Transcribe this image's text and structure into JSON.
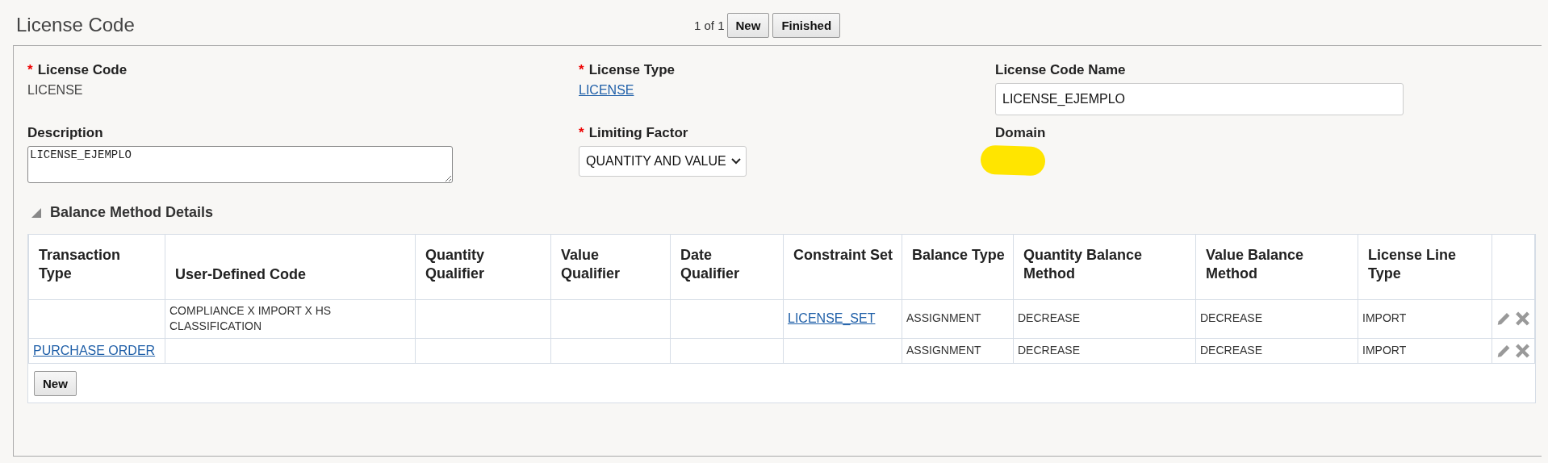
{
  "page": {
    "title": "License Code",
    "pager": "1 of 1",
    "buttons": [
      "New",
      "Finished"
    ]
  },
  "form": {
    "required_mark": "*",
    "license_code": {
      "label": "License Code",
      "required": true,
      "value": "LICENSE"
    },
    "license_type": {
      "label": "License Type",
      "required": true,
      "link": "LICENSE"
    },
    "license_code_name": {
      "label": "License Code Name",
      "required": false,
      "value": "LICENSE_EJEMPLO"
    },
    "description": {
      "label": "Description",
      "required": false,
      "value": "LICENSE_EJEMPLO"
    },
    "limiting_factor": {
      "label": "Limiting Factor",
      "required": true,
      "value": "QUANTITY AND VALUE"
    },
    "domain": {
      "label": "Domain",
      "required": false,
      "redacted": true
    }
  },
  "balance_section": {
    "title": "Balance Method Details",
    "expanded": true,
    "table": {
      "columns": [
        "Transaction Type",
        "User-Defined Code",
        "Quantity Qualifier",
        "Value Qualifier",
        "Date Qualifier",
        "Constraint Set",
        "Balance Type",
        "Quantity Balance Method",
        "Value Balance Method",
        "License Line Type"
      ],
      "rows": [
        {
          "cells": [
            {},
            {
              "text": "COMPLIANCE X IMPORT X HS CLASSIFICATION"
            },
            {},
            {},
            {},
            {
              "text": "LICENSE_SET",
              "link": true
            },
            {
              "text": "ASSIGNMENT"
            },
            {
              "text": "DECREASE"
            },
            {
              "text": "DECREASE"
            },
            {
              "text": "IMPORT"
            }
          ]
        },
        {
          "cells": [
            {
              "text": "PURCHASE ORDER",
              "link": true
            },
            {},
            {},
            {},
            {},
            {},
            {
              "text": "ASSIGNMENT"
            },
            {
              "text": "DECREASE"
            },
            {
              "text": "DECREASE"
            },
            {
              "text": "IMPORT"
            }
          ]
        }
      ]
    },
    "button": "New"
  }
}
